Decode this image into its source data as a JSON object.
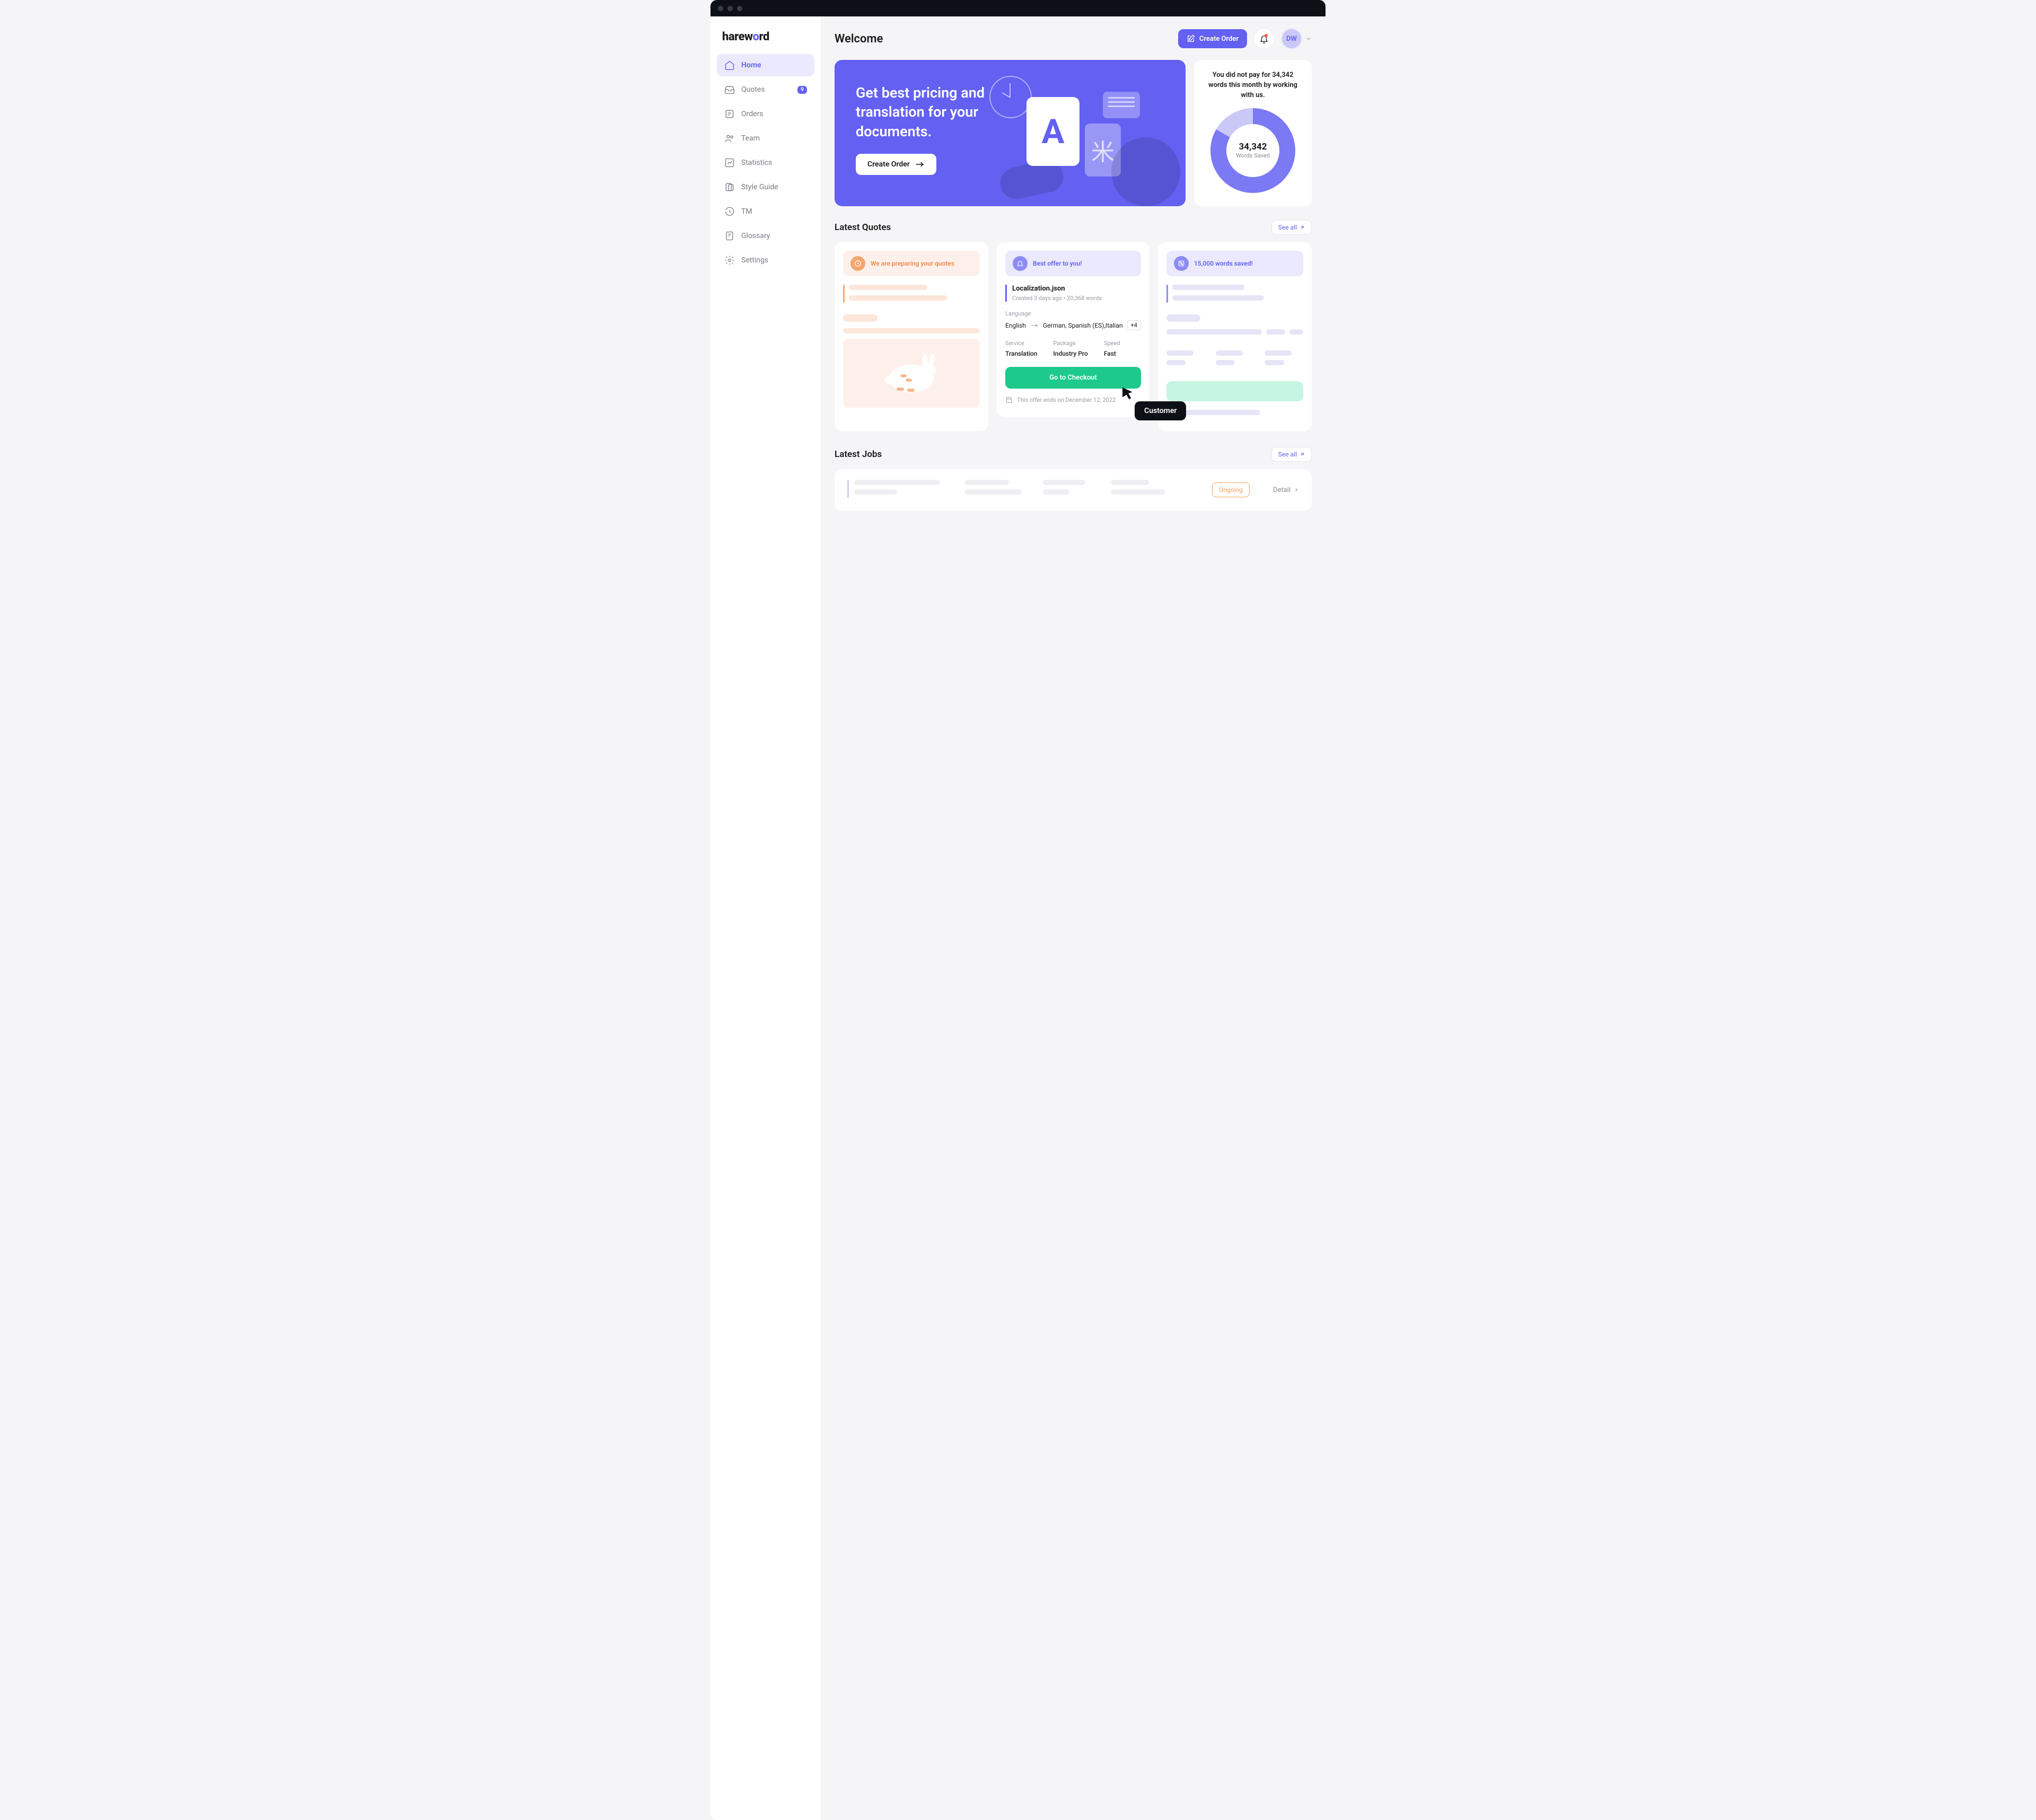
{
  "logo": {
    "text1": "harew",
    "accent": "o",
    "text2": "rd"
  },
  "sidebar": {
    "items": [
      {
        "label": "Home",
        "icon": "home",
        "active": true
      },
      {
        "label": "Quotes",
        "icon": "inbox",
        "badge": "9"
      },
      {
        "label": "Orders",
        "icon": "orders"
      },
      {
        "label": "Team",
        "icon": "team"
      },
      {
        "label": "Statistics",
        "icon": "stats"
      },
      {
        "label": "Style Guide",
        "icon": "styleguide"
      },
      {
        "label": "TM",
        "icon": "tm"
      },
      {
        "label": "Glossary",
        "icon": "glossary"
      },
      {
        "label": "Settings",
        "icon": "settings"
      }
    ]
  },
  "header": {
    "title": "Welcome",
    "create_label": "Create Order",
    "avatar": "DW"
  },
  "hero": {
    "title": "Get best pricing and translation for your documents.",
    "cta": "Create Order"
  },
  "stat": {
    "text": "You did not pay for 34,342 words this month by working with us.",
    "number": "34,342",
    "label": "Words Saved"
  },
  "quotes": {
    "section_title": "Latest Quotes",
    "see_all": "See all",
    "card1_banner": "We are preparing your quotes",
    "card2": {
      "banner": "Best offer to you!",
      "file": "Localization.json",
      "sub": "Created 3 days ago  •  20,368 words",
      "language_label": "Language",
      "lang_from": "English",
      "lang_to": "German, Spanish (ES),Italian",
      "lang_more": "+4",
      "service_label": "Service",
      "service": "Translation",
      "package_label": "Package",
      "package": "Industry Pro",
      "speed_label": "Speed",
      "speed": "Fast",
      "checkout": "Go to Checkout",
      "offer_ends": "This offer ends on December 12, 2022"
    },
    "card3_banner": "15,000 words saved!"
  },
  "jobs": {
    "section_title": "Latest Jobs",
    "see_all": "See all",
    "ongoing": "Ongoing",
    "detail": "Detail"
  },
  "cursor_label": "Customer"
}
